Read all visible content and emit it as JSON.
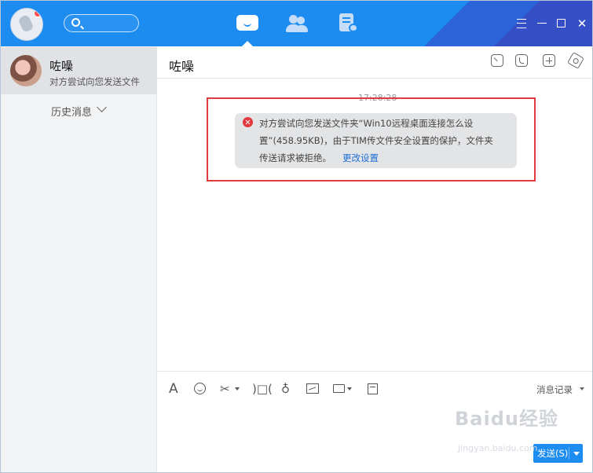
{
  "chat": {
    "title": "咗噪"
  },
  "sidebar": {
    "conversation": {
      "name": "咗噪",
      "preview": "对方尝试向您发送文件"
    },
    "history_label": "历史消息"
  },
  "message": {
    "timestamp": "17:28:28",
    "lines": [
      "对方尝试向您发送文件夹“Win10远程桌面连接怎么设",
      "置”(458.95KB)，由于TIM传文件安全设置的保护，文件夹",
      "传送请求被拒绝。"
    ],
    "link_label": "更改设置"
  },
  "input_toolbar": {
    "message_record_label": "消息记录",
    "send_label": "发送(S)"
  },
  "watermark": {
    "logo_text": "Baidu经验",
    "sub_text": "jingyan.baidu.com"
  },
  "icons": {
    "nav": [
      "message-icon",
      "contacts-icon",
      "docs-icon"
    ],
    "window": [
      "menu-icon",
      "minimize-icon",
      "maximize-icon",
      "close-icon"
    ],
    "chat_header": [
      "share-screen-icon",
      "phone-icon",
      "add-member-icon",
      "settings-icon"
    ],
    "toolbar": [
      "font-icon",
      "emoji-icon",
      "scissors-icon",
      "shake-icon",
      "mic-icon",
      "image-icon",
      "folder-icon",
      "screenshot-icon"
    ]
  },
  "colors": {
    "titlebar_blue": "#1d8cf0",
    "error_red": "#e4393c",
    "highlight_red": "#e0393e",
    "link_blue": "#1d6fd6",
    "send_blue": "#1e8df2"
  }
}
